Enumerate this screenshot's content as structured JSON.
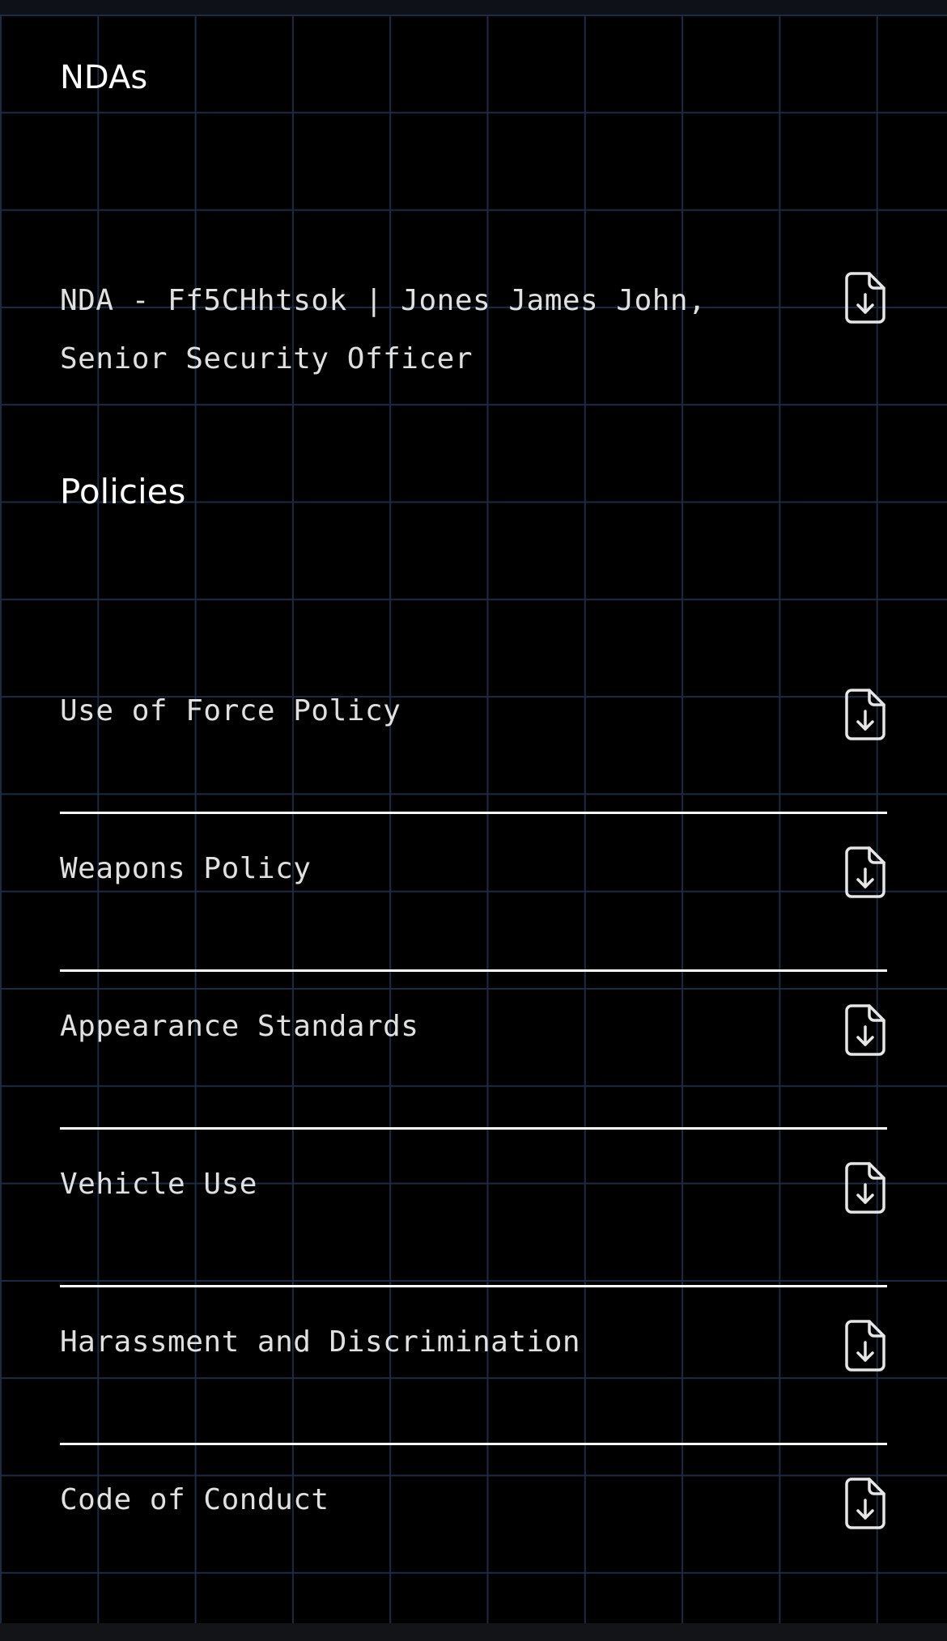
{
  "nda_section": {
    "title": "NDAs",
    "document": {
      "line1": "NDA - Ff5CHhtsok | Jones James John,",
      "line2": "Senior Security Officer",
      "icon": "file-download-icon"
    }
  },
  "policies_section": {
    "title": "Policies",
    "items": [
      {
        "label": "Use of Force Policy",
        "icon": "file-download-icon"
      },
      {
        "label": "Weapons Policy",
        "icon": "file-download-icon"
      },
      {
        "label": "Appearance Standards",
        "icon": "file-download-icon"
      },
      {
        "label": "Vehicle Use",
        "icon": "file-download-icon"
      },
      {
        "label": "Harassment and Discrimination",
        "icon": "file-download-icon"
      },
      {
        "label": "Code of Conduct",
        "icon": "file-download-icon"
      }
    ]
  },
  "colors": {
    "background": "#000000",
    "grid_lines": "#1c2b44",
    "text": "#e0e0e0",
    "divider": "#ffffff"
  }
}
